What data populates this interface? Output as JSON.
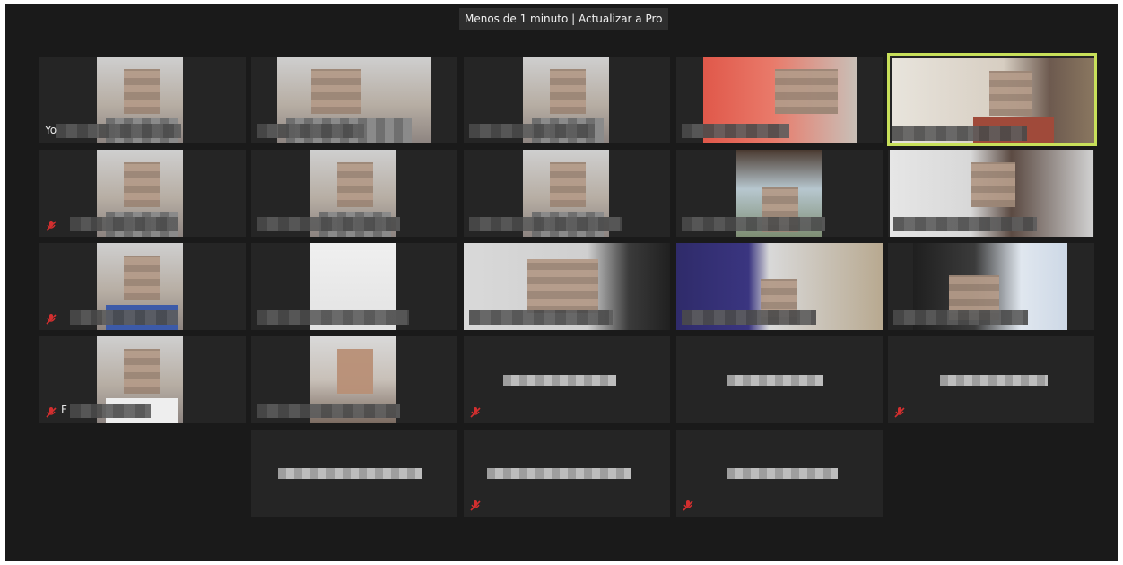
{
  "banner": {
    "text": "Menos de 1 minuto | Actualizar a Pro"
  },
  "colors": {
    "background": "#1a1a1a",
    "tile": "#252525",
    "active_speaker": "#c8e05a",
    "muted": "#d32f2f"
  },
  "participants": [
    {
      "label": "Yo",
      "muted": false
    },
    {
      "label": "",
      "muted": false
    },
    {
      "label": "",
      "muted": false
    },
    {
      "label": "",
      "muted": false
    },
    {
      "label": "",
      "muted": false,
      "active_speaker": true
    },
    {
      "label": "",
      "muted": true
    },
    {
      "label": "",
      "muted": false
    },
    {
      "label": "",
      "muted": false
    },
    {
      "label": "",
      "muted": false
    },
    {
      "label": "",
      "muted": false
    },
    {
      "label": "",
      "muted": true
    },
    {
      "label": "",
      "muted": false
    },
    {
      "label": "",
      "muted": false
    },
    {
      "label": "",
      "muted": false
    },
    {
      "label": "",
      "muted": false
    },
    {
      "label": "F",
      "muted": true
    },
    {
      "label": "",
      "muted": false
    },
    {
      "label": "",
      "muted": true
    },
    {
      "label": "",
      "muted": false
    },
    {
      "label": "",
      "muted": true
    },
    {
      "label": "",
      "muted": false
    },
    {
      "label": "",
      "muted": true
    },
    {
      "label": "",
      "muted": true
    }
  ],
  "icons": {
    "mute": "microphone-muted-icon"
  }
}
